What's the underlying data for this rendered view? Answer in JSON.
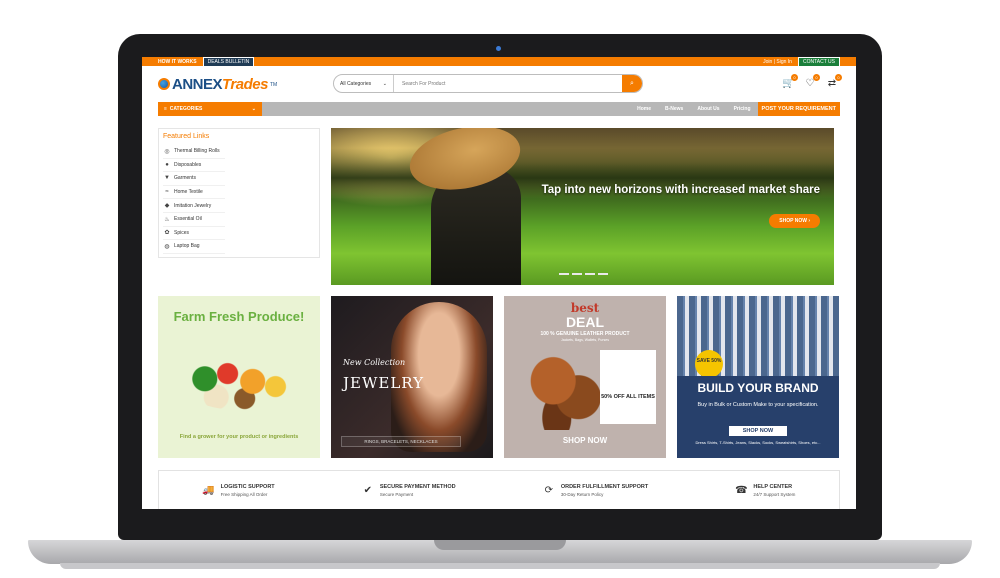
{
  "topbar": {
    "how_it_works": "HOW IT WORKS",
    "deals_bulletin": "DEALS BULLETIN",
    "join_signin": "Join | Sign In",
    "contact_us": "CONTACT US"
  },
  "brand": {
    "logo_text": "ANNEX",
    "logo_accent": "Trades",
    "tm": "TM"
  },
  "search": {
    "category": "All Categories",
    "placeholder": "Search For Product"
  },
  "header_icons": [
    {
      "icon": "cart-icon",
      "badge": "0"
    },
    {
      "icon": "heart-icon",
      "badge": "0"
    },
    {
      "icon": "compare-icon",
      "badge": "0"
    }
  ],
  "nav": {
    "categories": "CATEGORIES",
    "links": [
      "Home",
      "B-News",
      "About Us",
      "Pricing"
    ],
    "post": "POST YOUR REQUIREMENT"
  },
  "featured": {
    "title": "Featured Links",
    "items": [
      {
        "label": "Thermal Billing Rolls",
        "icon": "roll-icon"
      },
      {
        "label": "Disposables",
        "icon": "cup-icon"
      },
      {
        "label": "Garments",
        "icon": "shirt-icon"
      },
      {
        "label": "Home Textile",
        "icon": "textile-icon"
      },
      {
        "label": "Imitation Jewelry",
        "icon": "gem-icon"
      },
      {
        "label": "Essential Oil",
        "icon": "oil-icon"
      },
      {
        "label": "Spices",
        "icon": "spice-icon"
      },
      {
        "label": "Laptop Bag",
        "icon": "bag-icon"
      }
    ]
  },
  "hero": {
    "headline": "Tap into new horizons with increased market share",
    "cta": "SHOP NOW ›"
  },
  "tiles": {
    "farm": {
      "title": "Farm Fresh Produce!",
      "sub": "Find a grower for your product or ingredients"
    },
    "jewelry": {
      "script": "New Collection",
      "title": "JEWELRY",
      "band": "RINGS, BRACELETS, NECKLACES"
    },
    "leather": {
      "best": "best",
      "deal": "DEAL",
      "genuine": "100 % GENUINE LEATHER PRODUCT",
      "cats": "Jackets, Bags, Wallets, Purses",
      "off": "50% OFF ALL ITEMS",
      "shop": "SHOP NOW"
    },
    "brand": {
      "save": "SAVE 50%",
      "title": "BUILD YOUR BRAND",
      "sub": "Buy in Bulk or Custom Make to your specification.",
      "btn": "SHOP NOW",
      "list": "Dress Shirts, T-Shirts, Jeans, Slacks, Socks, Sweatshirts, Shoes, etc..."
    }
  },
  "features": [
    {
      "title": "LOGISTIC SUPPORT",
      "sub": "Free Shipping All Order",
      "icon": "truck-icon"
    },
    {
      "title": "SECURE PAYMENT METHOD",
      "sub": "Secure Payment",
      "icon": "check-circle-icon"
    },
    {
      "title": "ORDER FULFILLMENT SUPPORT",
      "sub": "30-Day Return Policy",
      "icon": "refresh-icon"
    },
    {
      "title": "HELP CENTER",
      "sub": "24/7 Support System",
      "icon": "support-icon"
    }
  ]
}
